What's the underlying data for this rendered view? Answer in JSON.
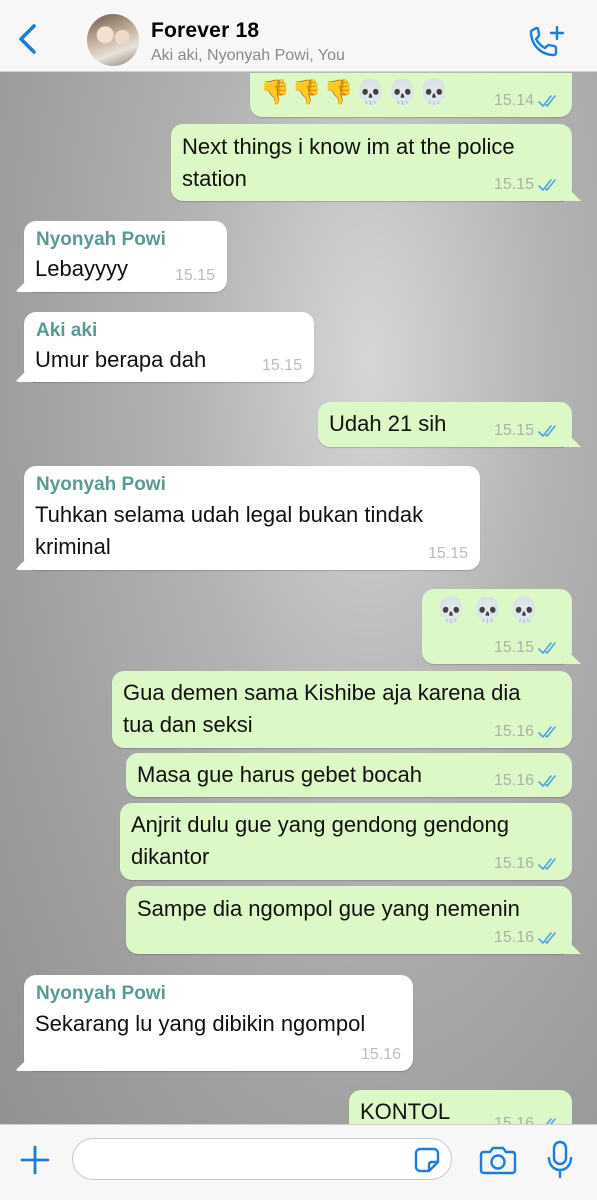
{
  "header": {
    "title": "Forever 18",
    "subtitle": "Aki aki, Nyonyah Powi, You",
    "back_icon": "chevron-left-icon",
    "call_icon": "phone-plus-icon",
    "accent": "#1a7ddb"
  },
  "messages": [
    {
      "dir": "out",
      "text": "👎👎👎💀💀💀",
      "time": "15.14"
    },
    {
      "dir": "out",
      "lines": [
        "Next things i know im at the police",
        "station"
      ],
      "time": "15.15"
    },
    {
      "dir": "in",
      "sender": "Nyonyah Powi",
      "text": "Lebayyyy",
      "time": "15.15"
    },
    {
      "dir": "in",
      "sender": "Aki aki",
      "text": "Umur berapa dah",
      "time": "15.15"
    },
    {
      "dir": "out",
      "text": "Udah 21 sih",
      "time": "15.15"
    },
    {
      "dir": "in",
      "sender": "Nyonyah Powi",
      "lines": [
        "Tuhkan selama udah legal bukan tindak",
        "kriminal"
      ],
      "time": "15.15"
    },
    {
      "dir": "out",
      "text": "💀 💀 💀",
      "time": "15.15"
    },
    {
      "dir": "out",
      "lines": [
        "Gua demen sama Kishibe aja karena dia",
        "tua dan seksi"
      ],
      "time": "15.16"
    },
    {
      "dir": "out",
      "text": "Masa gue harus gebet bocah",
      "time": "15.16"
    },
    {
      "dir": "out",
      "lines": [
        "Anjrit dulu gue yang gendong gendong",
        "dikantor"
      ],
      "time": "15.16"
    },
    {
      "dir": "out",
      "text": "Sampe dia ngompol gue yang nemenin",
      "time": "15.16"
    },
    {
      "dir": "in",
      "sender": "Nyonyah Powi",
      "text": "Sekarang lu yang dibikin ngompol",
      "time": "15.16"
    },
    {
      "dir": "out",
      "text": "KONTOL",
      "time": "15.16"
    }
  ],
  "composer": {
    "placeholder": "",
    "icons": [
      "plus-icon",
      "sticker-icon",
      "camera-icon",
      "microphone-icon"
    ]
  },
  "colors": {
    "outgoing_bubble": "#dcf8c6",
    "incoming_bubble": "#ffffff",
    "sender_name": "#5a9a93",
    "read_ticks": "#4fa3e0"
  }
}
